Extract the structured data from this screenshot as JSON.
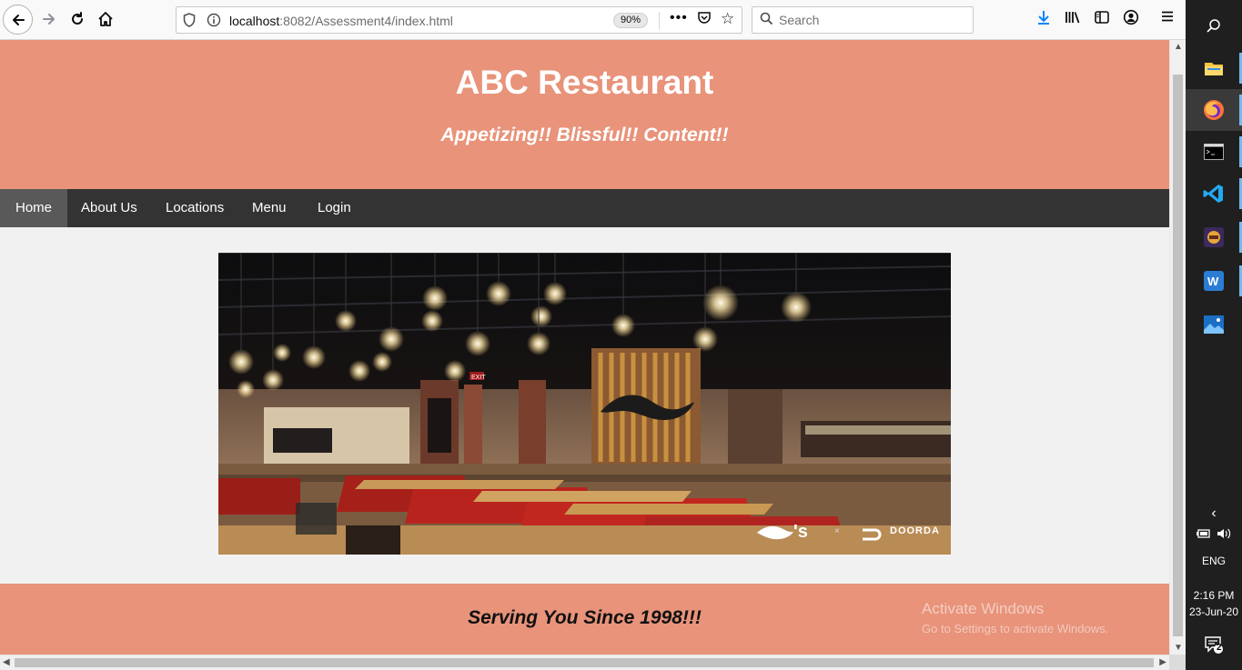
{
  "browser": {
    "url_host": "localhost",
    "url_rest": ":8082/Assessment4/index.html",
    "zoom": "90%",
    "search_placeholder": "Search"
  },
  "page": {
    "title": "ABC Restaurant",
    "tagline": "Appetizing!! Blissful!! Content!!",
    "nav": [
      {
        "label": "Home",
        "active": true
      },
      {
        "label": "About Us",
        "active": false
      },
      {
        "label": "Locations",
        "active": false
      },
      {
        "label": "Menu",
        "active": false
      },
      {
        "label": "Login",
        "active": false
      }
    ],
    "hero_image": {
      "exit_sign": "EXIT",
      "brand_logo": "'s",
      "partner_logo": "DOORDA"
    },
    "footer": "Serving You Since 1998!!!"
  },
  "watermark": {
    "title": "Activate Windows",
    "subtitle": "Go to Settings to activate Windows."
  },
  "taskbar": {
    "apps": [
      "file-explorer",
      "firefox",
      "command-prompt",
      "vscode",
      "game-app",
      "wps-writer",
      "photos"
    ],
    "language": "ENG",
    "time": "2:16 PM",
    "date": "23-Jun-20",
    "notification_count": "2"
  },
  "colors": {
    "header_bg": "#e8937a",
    "nav_bg": "#333333",
    "nav_active": "#595959",
    "page_bg": "#f1f1f1"
  }
}
